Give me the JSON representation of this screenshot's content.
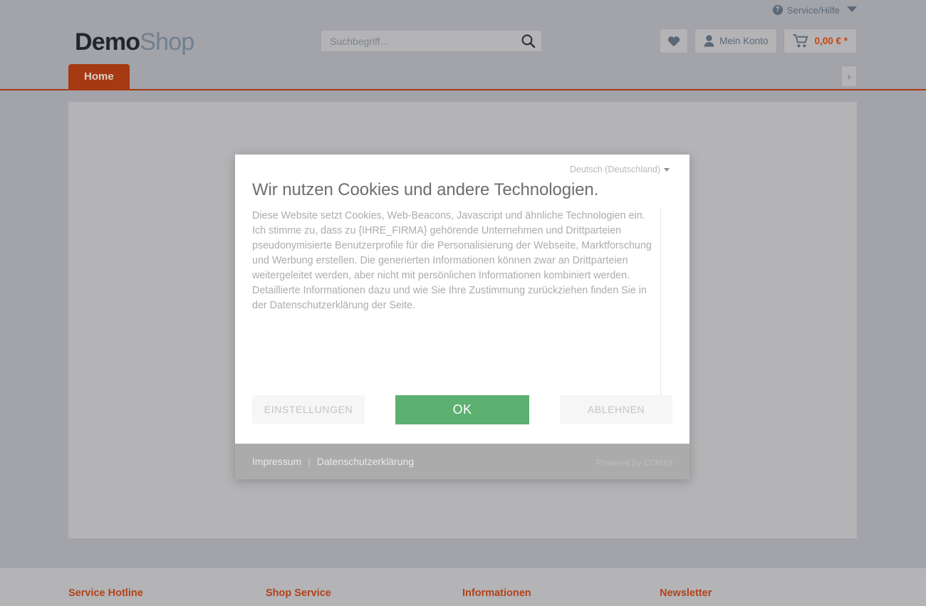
{
  "topbar": {
    "service_label": "Service/Hilfe",
    "help_icon": "question-circle-icon",
    "chevron_icon": "chevron-down-icon"
  },
  "header": {
    "logo_primary": "Demo",
    "logo_secondary": "Shop",
    "search": {
      "placeholder": "Suchbegriff...",
      "value": "",
      "icon": "search-icon"
    },
    "wishlist": {
      "icon": "heart-icon"
    },
    "account": {
      "label": "Mein Konto",
      "icon": "user-icon"
    },
    "cart": {
      "amount": "0,00 € *",
      "icon": "shopping-cart-icon"
    }
  },
  "nav": {
    "home_label": "Home",
    "next_label": "›"
  },
  "cookie_dialog": {
    "language": "Deutsch (Deutschland)",
    "language_caret": "caret-down-icon",
    "title": "Wir nutzen Cookies und andere Technologien.",
    "body": "Diese Website setzt Cookies, Web-Beacons, Javascript und ähnliche Technologien ein. Ich stimme zu, dass zu {IHRE_FIRMA} gehörende Unternehmen und Drittparteien pseudonymisierte Benutzerprofile für die Personalisierung der Webseite, Marktforschung und Werbung erstellen. Die generierten Informationen können zwar an Drittparteien weitergeleitet werden, aber nicht mit persönlichen Informationen kombiniert werden. Detaillierte Informationen dazu und wie Sie Ihre Zustimmung zurückziehen finden Sie in der Datenschutzerklärung der Seite.",
    "buttons": {
      "settings": "EINSTELLUNGEN",
      "accept": "OK",
      "decline": "ABLEHNEN"
    },
    "footer": {
      "imprint": "Impressum",
      "separator": "|",
      "privacy": "Datenschutzerklärung",
      "powered_by": "Powered by CCM19"
    },
    "accent_green": "#5cb070"
  },
  "site_footer": {
    "columns": [
      {
        "heading": "Service Hotline"
      },
      {
        "heading": "Shop Service"
      },
      {
        "heading": "Informationen"
      },
      {
        "heading": "Newsletter"
      }
    ],
    "accent": "#b1421a"
  }
}
